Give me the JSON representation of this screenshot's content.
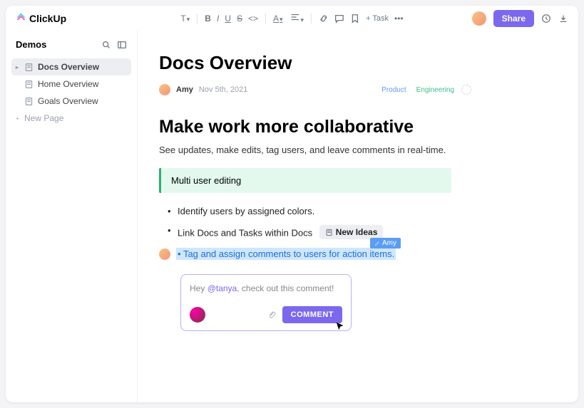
{
  "brand": "ClickUp",
  "toolbar": {
    "add_task": "+ Task"
  },
  "header": {
    "share": "Share"
  },
  "sidebar": {
    "title": "Demos",
    "items": [
      {
        "label": "Docs Overview",
        "active": true
      },
      {
        "label": "Home Overview"
      },
      {
        "label": "Goals Overview"
      }
    ],
    "new_page": "New Page"
  },
  "doc": {
    "title": "Docs Overview",
    "author": "Amy",
    "date": "Nov 5th, 2021",
    "tags": {
      "product": "Product",
      "engineering": "Engineering"
    },
    "h2": "Make work more collaborative",
    "sub": "See updates, make edits, tag users, and leave comments in real-time.",
    "callout": "Multi user editing",
    "bullets": {
      "b1": "Identify users by assigned colors.",
      "b2": "Link Docs and Tasks within Docs",
      "chip": "New Ideas",
      "b3": "Tag and assign comments to users for action items."
    },
    "presence": "Amy"
  },
  "comment": {
    "pre": "Hey ",
    "mention": "@tanya",
    "post": ", check out this comment!",
    "button": "COMMENT"
  }
}
